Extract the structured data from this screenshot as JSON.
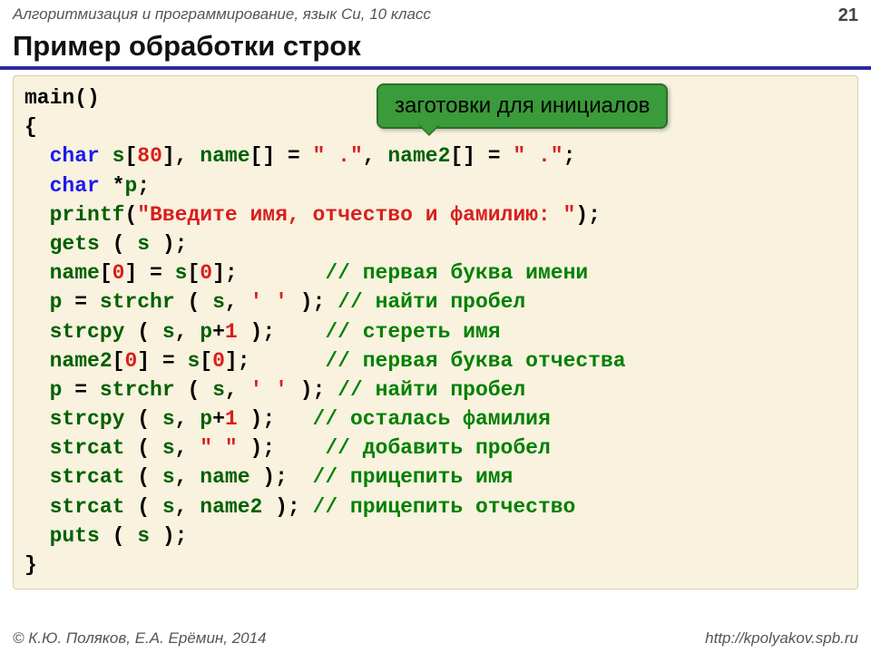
{
  "header": {
    "course": "Алгоритмизация и программирование, язык Си, 10 класс",
    "page": "21"
  },
  "title": "Пример обработки строк",
  "callout": "заготовки для инициалов",
  "code": {
    "l01a": "main()",
    "l02a": "{",
    "l03a": "  ",
    "l03kw": "char",
    "l03b": " ",
    "l03id1": "s",
    "l03c": "[",
    "l03n": "80",
    "l03d": "], ",
    "l03id2": "name",
    "l03e": "[] = ",
    "l03s1": "\" .\"",
    "l03f": ", ",
    "l03id3": "name2",
    "l03g": "[] = ",
    "l03s2": "\" .\"",
    "l03h": ";",
    "l04a": "  ",
    "l04kw": "char",
    "l04b": " *",
    "l04id": "p",
    "l04c": ";",
    "l05a": "  ",
    "l05id": "printf",
    "l05b": "(",
    "l05s": "\"Введите имя, отчество и фамилию: \"",
    "l05c": ");",
    "l06a": "  ",
    "l06id": "gets",
    "l06b": " ( ",
    "l06id2": "s",
    "l06c": " );",
    "l07a": "  ",
    "l07id": "name",
    "l07b": "[",
    "l07n1": "0",
    "l07c": "] = ",
    "l07id2": "s",
    "l07d": "[",
    "l07n2": "0",
    "l07e": "];       ",
    "l07com": "// первая буква имени",
    "l08a": "  ",
    "l08id": "p",
    "l08b": " = ",
    "l08fn": "strchr",
    "l08c": " ( ",
    "l08id2": "s",
    "l08d": ", ",
    "l08s": "' '",
    "l08e": " ); ",
    "l08com": "// найти пробел",
    "l09a": "  ",
    "l09fn": "strcpy",
    "l09b": " ( ",
    "l09id": "s",
    "l09c": ", ",
    "l09id2": "p",
    "l09d": "+",
    "l09n": "1",
    "l09e": " );    ",
    "l09com": "// стереть имя",
    "l10a": "  ",
    "l10id": "name2",
    "l10b": "[",
    "l10n1": "0",
    "l10c": "] = ",
    "l10id2": "s",
    "l10d": "[",
    "l10n2": "0",
    "l10e": "];      ",
    "l10com": "// первая буква отчества",
    "l11a": "  ",
    "l11id": "p",
    "l11b": " = ",
    "l11fn": "strchr",
    "l11c": " ( ",
    "l11id2": "s",
    "l11d": ", ",
    "l11s": "' '",
    "l11e": " ); ",
    "l11com": "// найти пробел",
    "l12a": "  ",
    "l12fn": "strcpy",
    "l12b": " ( ",
    "l12id": "s",
    "l12c": ", ",
    "l12id2": "p",
    "l12d": "+",
    "l12n": "1",
    "l12e": " );   ",
    "l12com": "// осталась фамилия",
    "l13a": "  ",
    "l13fn": "strcat",
    "l13b": " ( ",
    "l13id": "s",
    "l13c": ", ",
    "l13s": "\" \"",
    "l13d": " );    ",
    "l13com": "// добавить пробел",
    "l14a": "  ",
    "l14fn": "strcat",
    "l14b": " ( ",
    "l14id": "s",
    "l14c": ", ",
    "l14id2": "name",
    "l14d": " );  ",
    "l14com": "// прицепить имя",
    "l15a": "  ",
    "l15fn": "strcat",
    "l15b": " ( ",
    "l15id": "s",
    "l15c": ", ",
    "l15id2": "name2",
    "l15d": " ); ",
    "l15com": "// прицепить отчество",
    "l16a": "  ",
    "l16fn": "puts",
    "l16b": " ( ",
    "l16id": "s",
    "l16c": " );",
    "l17a": "}"
  },
  "footer": {
    "left": "© К.Ю. Поляков, Е.А. Ерёмин, 2014",
    "right": "http://kpolyakov.spb.ru"
  }
}
